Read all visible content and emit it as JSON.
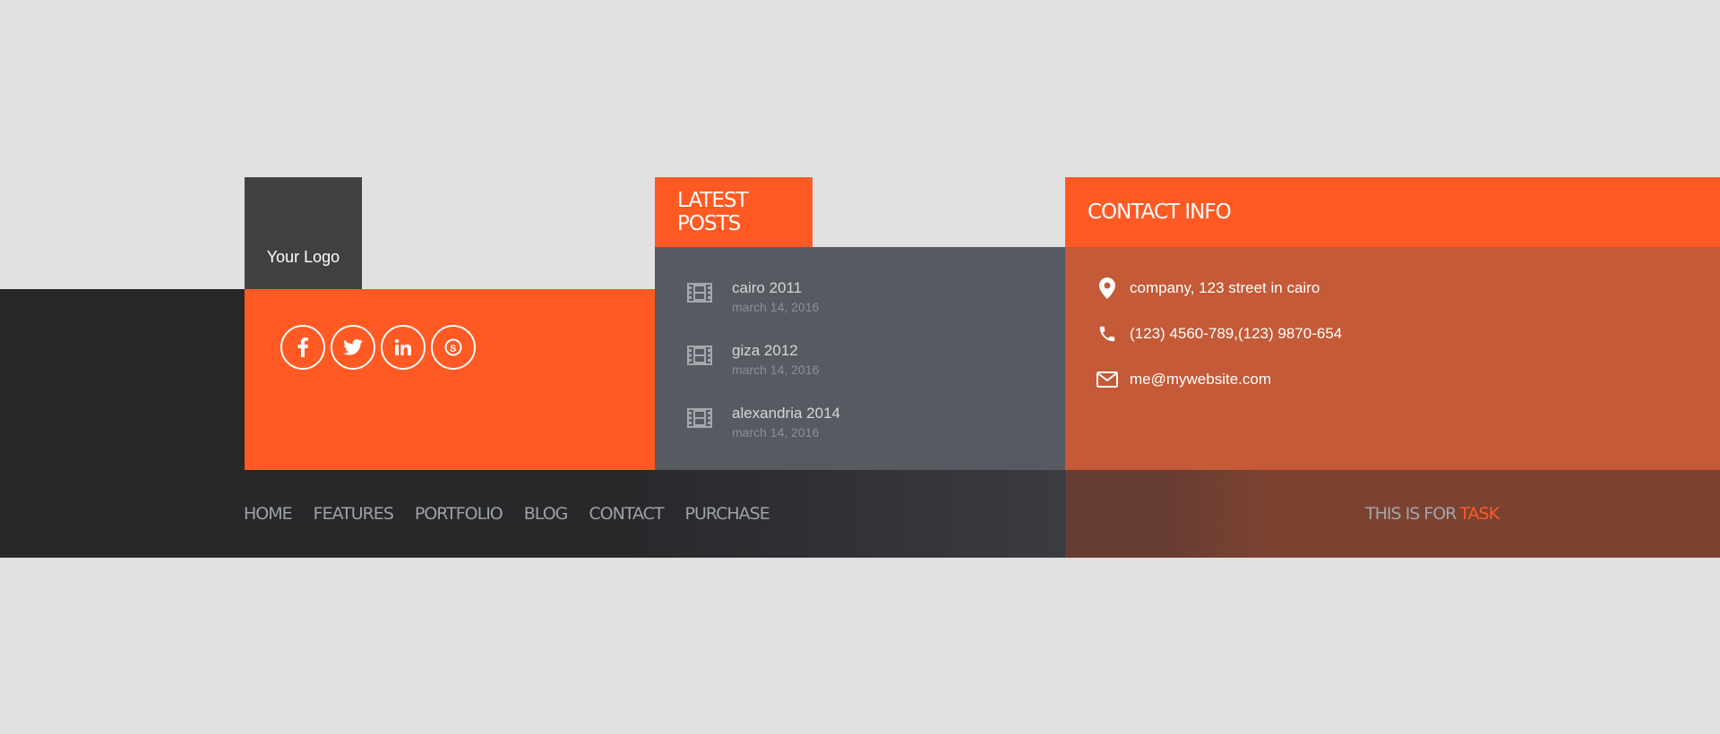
{
  "colors": {
    "accent": "#ff5a23",
    "dark": "#27282a",
    "posts_bg": "#575a60",
    "contact_bg": "#c45a37"
  },
  "logo": {
    "text": "Your Logo"
  },
  "social": [
    {
      "icon": "facebook-icon"
    },
    {
      "icon": "twitter-icon"
    },
    {
      "icon": "linkedin-icon"
    },
    {
      "icon": "skype-icon"
    }
  ],
  "latest_posts": {
    "title": "LATEST POSTS",
    "items": [
      {
        "icon": "film-icon",
        "title": "cairo 2011",
        "date": "march 14, 2016"
      },
      {
        "icon": "film-icon",
        "title": "giza 2012",
        "date": "march 14, 2016"
      },
      {
        "icon": "film-icon",
        "title": "alexandria 2014",
        "date": "march 14, 2016"
      }
    ]
  },
  "contact": {
    "title": "CONTACT INFO",
    "address": "company, 123 street in cairo",
    "phone": "(123) 4560-789,(123) 9870-654",
    "email": "me@mywebsite.com"
  },
  "nav": {
    "items": [
      "HOME",
      "FEATURES",
      "PORTFOLIO",
      "BLOG",
      "CONTACT",
      "PURCHASE"
    ]
  },
  "credit": {
    "prefix": "THIS IS FOR",
    "accent": "TASK"
  }
}
